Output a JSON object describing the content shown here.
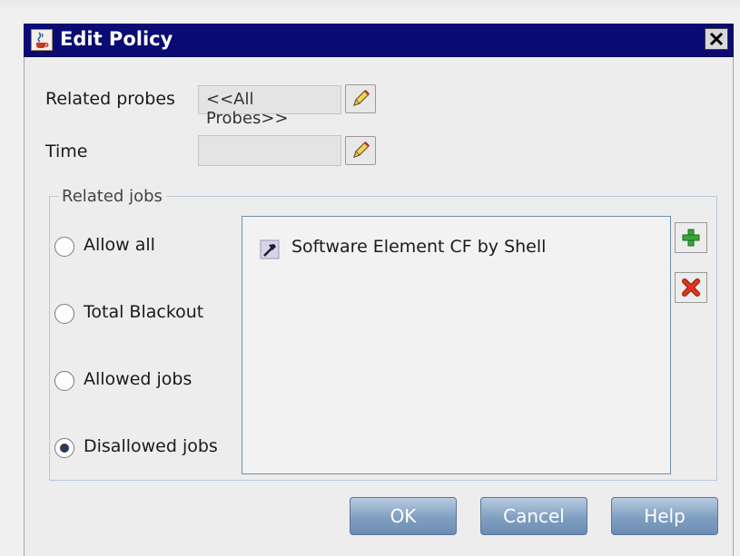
{
  "window": {
    "title": "Edit Policy",
    "title_icon": "java-cup-icon",
    "close_icon": "close-icon"
  },
  "form": {
    "related_probes_label": "Related probes",
    "related_probes_value": "<<All Probes>>",
    "time_label": "Time",
    "time_value": ""
  },
  "related_jobs": {
    "group_title": "Related jobs",
    "options": [
      {
        "label": "Allow all",
        "selected": false
      },
      {
        "label": "Total Blackout",
        "selected": false
      },
      {
        "label": "Allowed jobs",
        "selected": false
      },
      {
        "label": "Disallowed jobs",
        "selected": true
      }
    ],
    "jobs": [
      {
        "label": "Software Element CF by Shell",
        "icon": "hammer-icon"
      }
    ]
  },
  "buttons": {
    "ok": "OK",
    "cancel": "Cancel",
    "help": "Help"
  },
  "colors": {
    "title_bar": "#0b0b74",
    "button_blue": "#7f9fc1",
    "add_green": "#2f9a2f",
    "delete_red": "#d42a1a"
  }
}
